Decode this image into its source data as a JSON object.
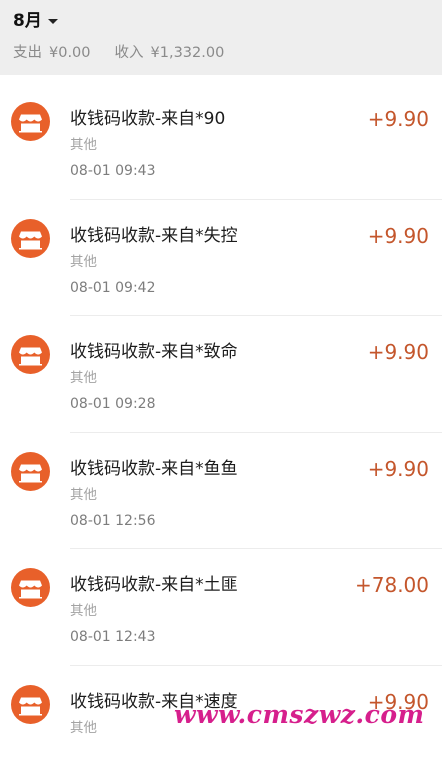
{
  "header": {
    "month": "8月",
    "expense_label": "支出",
    "expense_value": "¥0.00",
    "income_label": "收入",
    "income_value": "¥1,332.00"
  },
  "transactions": [
    {
      "title": "收钱码收款-来自*90",
      "category": "其他",
      "time": "08-01 09:43",
      "amount": "+9.90"
    },
    {
      "title": "收钱码收款-来自*失控",
      "category": "其他",
      "time": "08-01 09:42",
      "amount": "+9.90"
    },
    {
      "title": "收钱码收款-来自*致命",
      "category": "其他",
      "time": "08-01 09:28",
      "amount": "+9.90"
    },
    {
      "title": "收钱码收款-来自*鱼鱼",
      "category": "其他",
      "time": "08-01 12:56",
      "amount": "+9.90"
    },
    {
      "title": "收钱码收款-来自*土匪",
      "category": "其他",
      "time": "08-01 12:43",
      "amount": "+78.00"
    },
    {
      "title": "收钱码收款-来自*速度",
      "category": "其他",
      "time": "",
      "amount": "+9.90"
    }
  ],
  "icons": {
    "header_caret": "caret-down-icon",
    "row_icon": "shop-icon"
  },
  "colors": {
    "accent": "#e8602a",
    "amount": "#c4562c",
    "header_bg": "#eeeeee"
  },
  "watermark": "www.cmszwz.com"
}
